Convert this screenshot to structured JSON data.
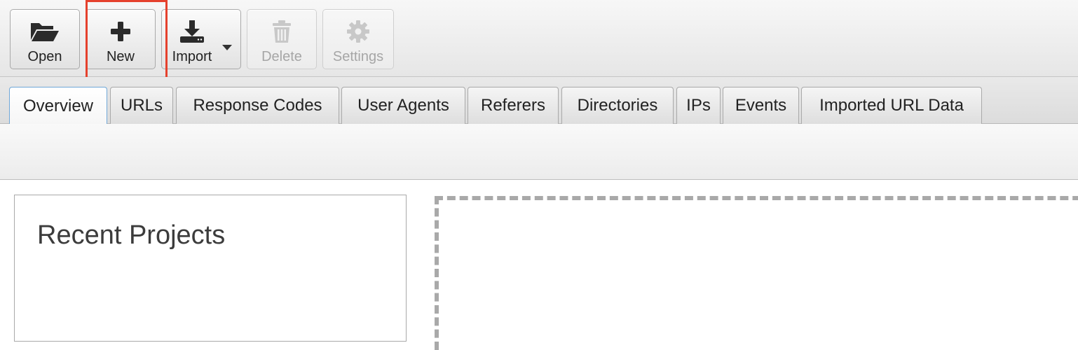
{
  "toolbar": {
    "buttons": [
      {
        "label": "Open",
        "icon": "folder-open-icon",
        "enabled": true
      },
      {
        "label": "New",
        "icon": "plus-icon",
        "enabled": true,
        "highlighted": true
      },
      {
        "label": "Import",
        "icon": "download-icon",
        "enabled": true,
        "has_dropdown": true
      },
      {
        "label": "Delete",
        "icon": "trash-icon",
        "enabled": false
      },
      {
        "label": "Settings",
        "icon": "gear-icon",
        "enabled": false
      }
    ]
  },
  "tabs": [
    {
      "label": "Overview",
      "active": true
    },
    {
      "label": "URLs",
      "active": false
    },
    {
      "label": "Response Codes",
      "active": false
    },
    {
      "label": "User Agents",
      "active": false
    },
    {
      "label": "Referers",
      "active": false
    },
    {
      "label": "Directories",
      "active": false
    },
    {
      "label": "IPs",
      "active": false
    },
    {
      "label": "Events",
      "active": false
    },
    {
      "label": "Imported URL Data",
      "active": false
    }
  ],
  "main": {
    "recent_projects_title": "Recent Projects"
  },
  "colors": {
    "highlight": "#e5412d",
    "active_tab_border": "#6fa7d8",
    "icon_enabled": "#2b2b2b",
    "icon_disabled": "#c8c8c8"
  }
}
